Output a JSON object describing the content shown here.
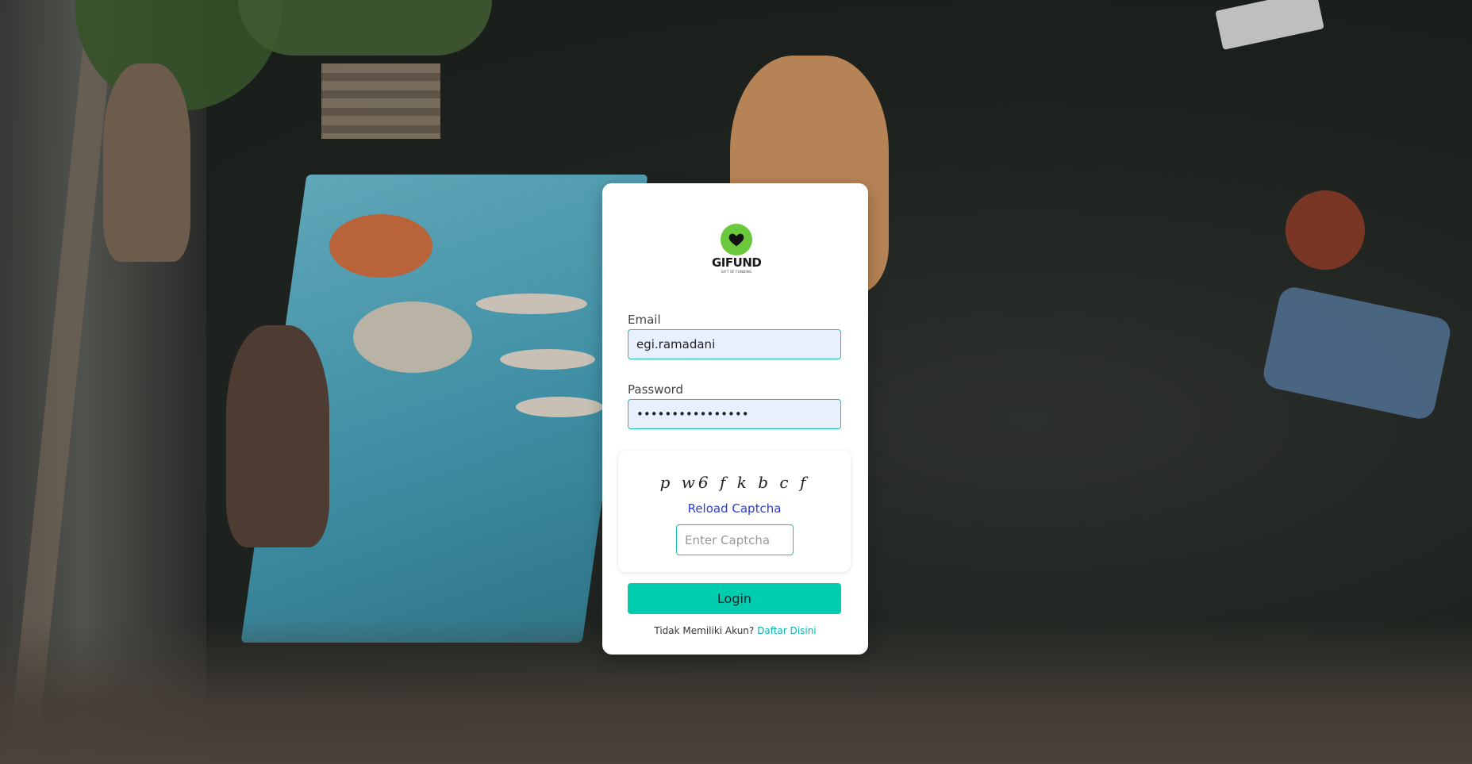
{
  "background": {
    "description_icon": "market-photo-background"
  },
  "logo": {
    "name": "GIFUND",
    "tagline": "GIFT OF FUNDING"
  },
  "form": {
    "email_label": "Email",
    "email_value": "egi.ramadani",
    "password_label": "Password",
    "password_value": "••••••••••••••••"
  },
  "captcha": {
    "code": "p w6 f k b c f",
    "reload_label": "Reload Captcha",
    "input_placeholder": "Enter Captcha",
    "input_value": ""
  },
  "actions": {
    "login_label": "Login"
  },
  "footer": {
    "prompt": "Tidak Memiliki Akun?",
    "link_label": "Daftar Disini"
  },
  "colors": {
    "accent": "#00ccb0",
    "link": "#2a3cd6",
    "logo_green": "#6bc73c"
  }
}
